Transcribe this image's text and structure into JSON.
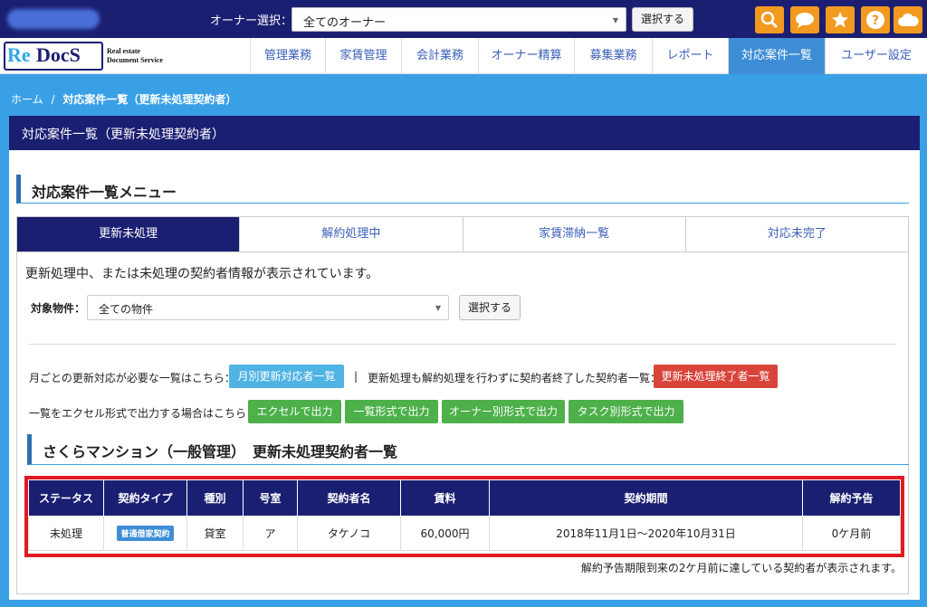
{
  "header": {
    "owner_label": "オーナー選択：",
    "owner_value": "全てのオーナー",
    "select_btn": "選択する",
    "icons": [
      "search-icon",
      "chat-icon",
      "star-icon",
      "help-icon",
      "cloud-icon"
    ],
    "accent": "#f2991f"
  },
  "logo": {
    "re": "Re",
    "docs": "DocS",
    "sub1": "Real estate",
    "sub2": "Document Service"
  },
  "nav": {
    "items": [
      "管理業務",
      "家賃管理",
      "会計業務",
      "オーナー精算",
      "募集業務",
      "レポート",
      "対応案件一覧",
      "ユーザー設定"
    ],
    "active": "対応案件一覧"
  },
  "breadcrumb": {
    "home": "ホーム",
    "sep": "/",
    "current": "対応案件一覧（更新未処理契約者）"
  },
  "panel": {
    "title": "対応案件一覧（更新未処理契約者）",
    "menu_title": "対応案件一覧メニュー",
    "tabs": [
      "更新未処理",
      "解約処理中",
      "家賃滞納一覧",
      "対応未完了"
    ],
    "description": "更新処理中、または未処理の契約者情報が表示されています。",
    "filter_label": "対象物件：",
    "filter_value": "全ての物件",
    "filter_btn": "選択する",
    "monthly_text": "月ごとの更新対応が必要な一覧はこちら：",
    "monthly_btn": "月別更新対応者一覧",
    "separator": "|",
    "ended_text": "更新処理も解約処理を行わずに契約者終了した契約者一覧：",
    "ended_btn": "更新未処理終了者一覧",
    "excel_text": "一覧をエクセル形式で出力する場合はこちら：",
    "export_btns": [
      "エクセルで出力",
      "一覧形式で出力",
      "オーナー別形式で出力",
      "タスク別形式で出力"
    ],
    "sub_title": "さくらマンション（一般管理）　更新未処理契約者一覧",
    "table": {
      "headers": [
        "ステータス",
        "契約タイプ",
        "種別",
        "号室",
        "契約者名",
        "賃料",
        "契約期間",
        "解約予告"
      ],
      "rows": [
        [
          "未処理",
          "普通借家契約",
          "貸室",
          "ア",
          "タケノコ",
          "60,000円",
          "2018年11月1日～2020年10月31日",
          "0ケ月前"
        ]
      ]
    },
    "note": "解約予告期限到来の2ケ月前に達している契約者が表示されます。"
  }
}
